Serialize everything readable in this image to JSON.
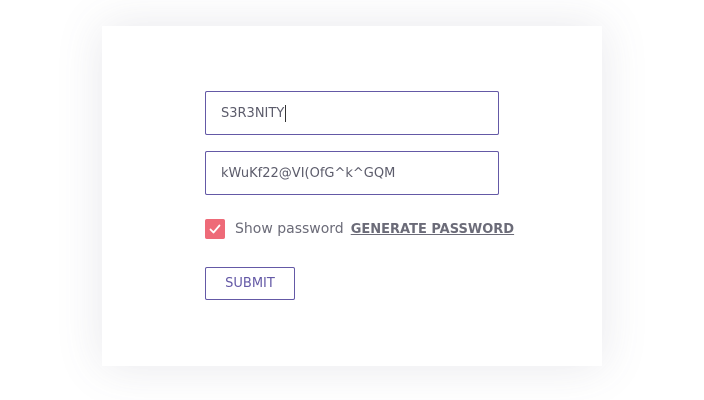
{
  "form": {
    "username_value": "S3R3NITY",
    "password_value": "kWuKf22@VI(OfG^k^GQM",
    "show_password": {
      "label": "Show password",
      "checked": true,
      "icon": "check-icon"
    },
    "generate_password_label": "GENERATE PASSWORD",
    "submit_label": "SUBMIT"
  },
  "colors": {
    "accent": "#6459a6",
    "checkbox_fill": "#ee6a78",
    "text": "#6b6b78",
    "card_background": "#ffffff"
  }
}
